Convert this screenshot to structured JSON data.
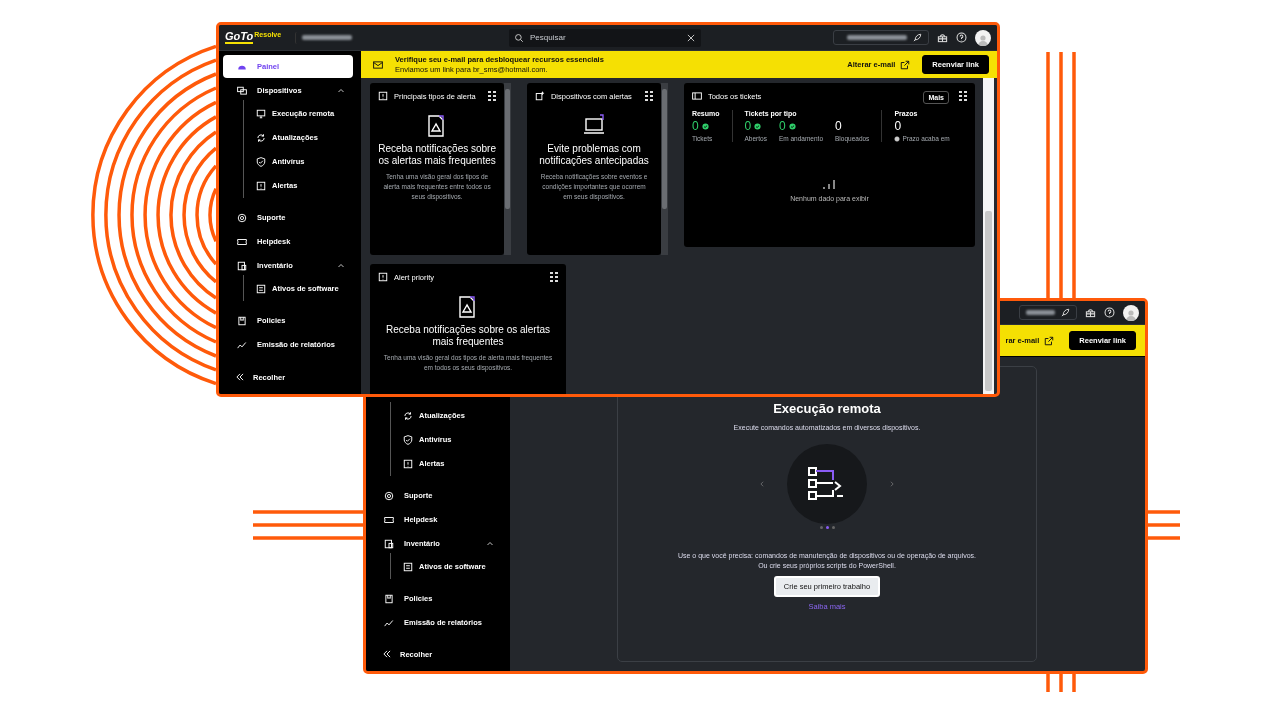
{
  "front_window": {
    "header": {
      "logo": "GoTo",
      "logo_tag": "Resolve",
      "search": {
        "placeholder": "Pesquisar"
      }
    },
    "sidebar": {
      "items": [
        {
          "label": "Painel",
          "selected": true
        },
        {
          "label": "Dispositivos",
          "selected": false,
          "expanded": true,
          "children": [
            {
              "label": "Execução remota",
              "selected": false
            },
            {
              "label": "Atualizações",
              "selected": false
            },
            {
              "label": "Antivírus",
              "selected": false
            },
            {
              "label": "Alertas",
              "selected": false
            }
          ]
        },
        {
          "label": "Suporte",
          "selected": false
        },
        {
          "label": "Helpdesk",
          "selected": false
        },
        {
          "label": "Inventário",
          "selected": false,
          "expanded": true,
          "children": [
            {
              "label": "Ativos de software",
              "selected": false
            }
          ]
        },
        {
          "label": "Policies",
          "selected": false
        },
        {
          "label": "Emissão de relatórios",
          "selected": false
        }
      ],
      "collapse": "Recolher"
    },
    "banner": {
      "title": "Verifique seu e-mail para desbloquear recursos essenciais",
      "message": "Enviamos um link para br_sms@hotmail.com.",
      "change_email": "Alterar e-mail",
      "resend": "Reenviar link"
    },
    "card_rows": [
      [
        {
          "kind": "feature",
          "title": "Principais tipos de alerta",
          "headline": "Receba notificações sobre os alertas mais frequentes",
          "description": "Tenha uma visão geral dos tipos de alerta mais frequentes entre todos os seus dispositivos."
        },
        {
          "kind": "feature",
          "title": "Dispositivos com alertas",
          "headline": "Evite problemas com notificações antecipadas",
          "description": "Receba notificações sobre eventos e condições importantes que ocorrem em seus dispositivos."
        },
        {
          "kind": "tickets",
          "title": "Todos os tickets",
          "more": "Mais",
          "sections": [
            {
              "title": "Resumo",
              "stats": [
                {
                  "value": "0",
                  "label": "Tickets",
                  "ok": true
                }
              ]
            },
            {
              "title": "Tickets por tipo",
              "stats": [
                {
                  "value": "0",
                  "label": "Abertos",
                  "ok": true
                },
                {
                  "value": "0",
                  "label": "Em andamento",
                  "ok": true
                },
                {
                  "value": "0",
                  "label": "Bloqueados",
                  "ok": false
                }
              ]
            },
            {
              "title": "Prazos",
              "stats": [
                {
                  "value": "0",
                  "label": "Prazo acaba em",
                  "ok": false
                }
              ]
            }
          ],
          "empty": "Nenhum dado para exibir"
        }
      ],
      [
        {
          "kind": "feature",
          "title": "Alert priority",
          "headline": "Receba notificações sobre os alertas mais frequentes",
          "description": "Tenha uma visão geral dos tipos de alerta mais frequentes em todos os seus dispositivos."
        }
      ]
    ]
  },
  "back_window": {
    "banner": {
      "change_email": "rar e-mail",
      "resend": "Reenviar link"
    },
    "sidebar": {
      "subitems": [
        {
          "label": "Atualizações",
          "selected": false
        },
        {
          "label": "Antivírus",
          "selected": false
        },
        {
          "label": "Alertas",
          "selected": false
        }
      ],
      "items": [
        {
          "label": "Suporte",
          "selected": false
        },
        {
          "label": "Helpdesk",
          "selected": false
        },
        {
          "label": "Inventário",
          "selected": false,
          "expanded": true,
          "children": [
            {
              "label": "Ativos de software",
              "selected": false
            }
          ]
        },
        {
          "label": "Policies",
          "selected": false
        },
        {
          "label": "Emissão de relatórios",
          "selected": false
        }
      ],
      "collapse": "Recolher"
    },
    "panel": {
      "title": "Execução remota",
      "subtitle": "Execute comandos automatizados em diversos dispositivos.",
      "slides": [
        {
          "selected": false
        },
        {
          "selected": true
        },
        {
          "selected": false
        }
      ],
      "description_lines": [
        "Use o que você precisa: comandos de manutenção de dispositivos ou de operação de arquivos.",
        "Ou crie seus próprios scripts do PowerShell."
      ],
      "button": "Crie seu primeiro trabalho",
      "link": "Saiba mais"
    }
  }
}
